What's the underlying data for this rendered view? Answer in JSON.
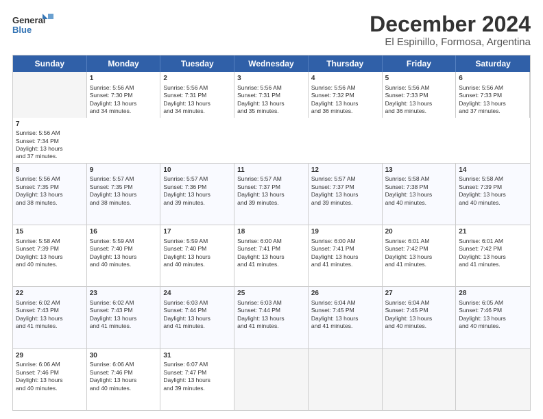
{
  "header": {
    "logo_line1": "General",
    "logo_line2": "Blue",
    "month": "December 2024",
    "location": "El Espinillo, Formosa, Argentina"
  },
  "weekdays": [
    "Sunday",
    "Monday",
    "Tuesday",
    "Wednesday",
    "Thursday",
    "Friday",
    "Saturday"
  ],
  "rows": [
    [
      {
        "day": "",
        "info": ""
      },
      {
        "day": "2",
        "info": "Sunrise: 5:56 AM\nSunset: 7:31 PM\nDaylight: 13 hours\nand 34 minutes."
      },
      {
        "day": "3",
        "info": "Sunrise: 5:56 AM\nSunset: 7:31 PM\nDaylight: 13 hours\nand 35 minutes."
      },
      {
        "day": "4",
        "info": "Sunrise: 5:56 AM\nSunset: 7:32 PM\nDaylight: 13 hours\nand 36 minutes."
      },
      {
        "day": "5",
        "info": "Sunrise: 5:56 AM\nSunset: 7:33 PM\nDaylight: 13 hours\nand 36 minutes."
      },
      {
        "day": "6",
        "info": "Sunrise: 5:56 AM\nSunset: 7:33 PM\nDaylight: 13 hours\nand 37 minutes."
      },
      {
        "day": "7",
        "info": "Sunrise: 5:56 AM\nSunset: 7:34 PM\nDaylight: 13 hours\nand 37 minutes."
      }
    ],
    [
      {
        "day": "8",
        "info": "Sunrise: 5:56 AM\nSunset: 7:35 PM\nDaylight: 13 hours\nand 38 minutes."
      },
      {
        "day": "9",
        "info": "Sunrise: 5:57 AM\nSunset: 7:35 PM\nDaylight: 13 hours\nand 38 minutes."
      },
      {
        "day": "10",
        "info": "Sunrise: 5:57 AM\nSunset: 7:36 PM\nDaylight: 13 hours\nand 39 minutes."
      },
      {
        "day": "11",
        "info": "Sunrise: 5:57 AM\nSunset: 7:37 PM\nDaylight: 13 hours\nand 39 minutes."
      },
      {
        "day": "12",
        "info": "Sunrise: 5:57 AM\nSunset: 7:37 PM\nDaylight: 13 hours\nand 39 minutes."
      },
      {
        "day": "13",
        "info": "Sunrise: 5:58 AM\nSunset: 7:38 PM\nDaylight: 13 hours\nand 40 minutes."
      },
      {
        "day": "14",
        "info": "Sunrise: 5:58 AM\nSunset: 7:39 PM\nDaylight: 13 hours\nand 40 minutes."
      }
    ],
    [
      {
        "day": "15",
        "info": "Sunrise: 5:58 AM\nSunset: 7:39 PM\nDaylight: 13 hours\nand 40 minutes."
      },
      {
        "day": "16",
        "info": "Sunrise: 5:59 AM\nSunset: 7:40 PM\nDaylight: 13 hours\nand 40 minutes."
      },
      {
        "day": "17",
        "info": "Sunrise: 5:59 AM\nSunset: 7:40 PM\nDaylight: 13 hours\nand 40 minutes."
      },
      {
        "day": "18",
        "info": "Sunrise: 6:00 AM\nSunset: 7:41 PM\nDaylight: 13 hours\nand 41 minutes."
      },
      {
        "day": "19",
        "info": "Sunrise: 6:00 AM\nSunset: 7:41 PM\nDaylight: 13 hours\nand 41 minutes."
      },
      {
        "day": "20",
        "info": "Sunrise: 6:01 AM\nSunset: 7:42 PM\nDaylight: 13 hours\nand 41 minutes."
      },
      {
        "day": "21",
        "info": "Sunrise: 6:01 AM\nSunset: 7:42 PM\nDaylight: 13 hours\nand 41 minutes."
      }
    ],
    [
      {
        "day": "22",
        "info": "Sunrise: 6:02 AM\nSunset: 7:43 PM\nDaylight: 13 hours\nand 41 minutes."
      },
      {
        "day": "23",
        "info": "Sunrise: 6:02 AM\nSunset: 7:43 PM\nDaylight: 13 hours\nand 41 minutes."
      },
      {
        "day": "24",
        "info": "Sunrise: 6:03 AM\nSunset: 7:44 PM\nDaylight: 13 hours\nand 41 minutes."
      },
      {
        "day": "25",
        "info": "Sunrise: 6:03 AM\nSunset: 7:44 PM\nDaylight: 13 hours\nand 41 minutes."
      },
      {
        "day": "26",
        "info": "Sunrise: 6:04 AM\nSunset: 7:45 PM\nDaylight: 13 hours\nand 41 minutes."
      },
      {
        "day": "27",
        "info": "Sunrise: 6:04 AM\nSunset: 7:45 PM\nDaylight: 13 hours\nand 40 minutes."
      },
      {
        "day": "28",
        "info": "Sunrise: 6:05 AM\nSunset: 7:46 PM\nDaylight: 13 hours\nand 40 minutes."
      }
    ],
    [
      {
        "day": "29",
        "info": "Sunrise: 6:06 AM\nSunset: 7:46 PM\nDaylight: 13 hours\nand 40 minutes."
      },
      {
        "day": "30",
        "info": "Sunrise: 6:06 AM\nSunset: 7:46 PM\nDaylight: 13 hours\nand 40 minutes."
      },
      {
        "day": "31",
        "info": "Sunrise: 6:07 AM\nSunset: 7:47 PM\nDaylight: 13 hours\nand 39 minutes."
      },
      {
        "day": "",
        "info": ""
      },
      {
        "day": "",
        "info": ""
      },
      {
        "day": "",
        "info": ""
      },
      {
        "day": "",
        "info": ""
      }
    ]
  ],
  "row1_day1": {
    "day": "1",
    "info": "Sunrise: 5:56 AM\nSunset: 7:30 PM\nDaylight: 13 hours\nand 34 minutes."
  }
}
